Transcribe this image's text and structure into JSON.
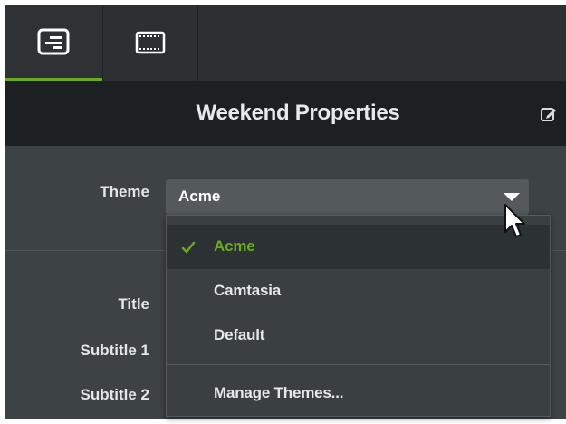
{
  "tabs": [
    {
      "icon": "properties-icon",
      "active": true
    },
    {
      "icon": "film-icon",
      "active": false
    }
  ],
  "header": {
    "title": "Weekend Properties",
    "edit_icon": "edit-icon"
  },
  "theme": {
    "label": "Theme",
    "value": "Acme"
  },
  "form": {
    "title_label": "Title",
    "subtitle1_label": "Subtitle 1",
    "subtitle2_label": "Subtitle 2"
  },
  "menu": {
    "items": [
      {
        "label": "Acme",
        "selected": true
      },
      {
        "label": "Camtasia",
        "selected": false
      },
      {
        "label": "Default",
        "selected": false
      }
    ],
    "manage_label": "Manage Themes..."
  },
  "colors": {
    "accent": "#6aaa1f",
    "panel": "#3d4245",
    "header": "#1d2022",
    "tabbar": "#2c3033"
  }
}
